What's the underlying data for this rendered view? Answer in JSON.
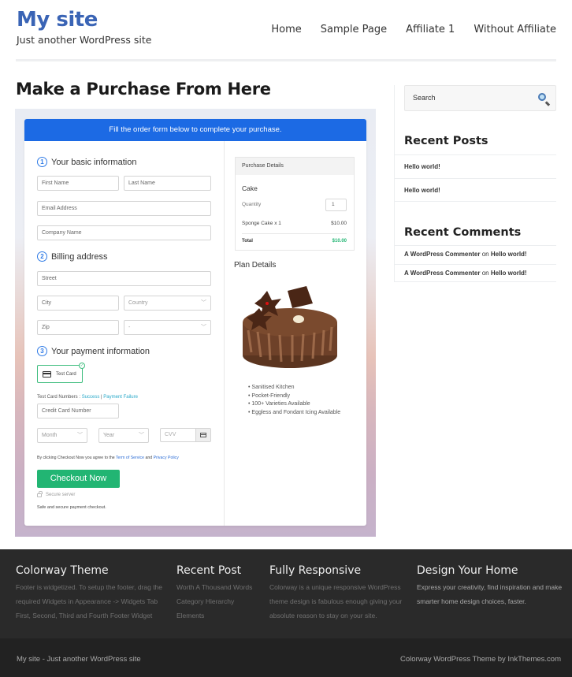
{
  "header": {
    "site_title": "My site",
    "tagline": "Just another WordPress site",
    "nav": [
      "Home",
      "Sample Page",
      "Affiliate 1",
      "Without Affiliate"
    ]
  },
  "main": {
    "page_title": "Make a Purchase From Here",
    "banner": "Fill the order form below to complete your purchase.",
    "steps": [
      {
        "num": "1",
        "label": "Your basic information"
      },
      {
        "num": "2",
        "label": "Billing address"
      },
      {
        "num": "3",
        "label": "Your payment information"
      }
    ],
    "fields": {
      "first_name": "First Name",
      "last_name": "Last Name",
      "email": "Email Address",
      "company": "Company Name",
      "street": "Street",
      "city": "City",
      "country": "Country",
      "zip": "Zip",
      "state": "-",
      "card_number": "Credit Card Number",
      "month": "Month",
      "year": "Year",
      "cvv": "CVV"
    },
    "payment_method": "Test Card",
    "test_numbers_label": "Test Card Numbers : ",
    "test_success": "Success",
    "test_sep": " | ",
    "test_failure": "Payment Failure",
    "agree_prefix": "By clicking Checkout Now you agree to the ",
    "terms_link": "Term of Service",
    "agree_and": " and ",
    "privacy_link": "Privacy Policy",
    "checkout_button": "Checkout Now",
    "secure_server": "Secure server",
    "safe_text": "Safe and secure payment checkout.",
    "purchase": {
      "header": "Purchase Details",
      "item": "Cake",
      "quantity_label": "Quantity",
      "quantity": "1",
      "line_label": "Sponge Cake x 1",
      "line_amount": "$10.00",
      "total_label": "Total",
      "total_amount": "$10.00"
    },
    "plan_title": "Plan Details",
    "features": [
      "Sanitised Kitchen",
      "Pocket-Friendly",
      "100+ Varieties Available",
      "Eggless and Fondant Icing Available"
    ]
  },
  "sidebar": {
    "search_placeholder": "Search",
    "recent_posts_title": "Recent Posts",
    "recent_posts": [
      "Hello world!",
      "Hello world!"
    ],
    "recent_comments_title": "Recent Comments",
    "recent_comments": [
      {
        "author": "A WordPress Commenter",
        "on": " on ",
        "post": "Hello world!"
      },
      {
        "author": "A WordPress Commenter",
        "on": " on ",
        "post": "Hello world!"
      }
    ]
  },
  "footer": {
    "cols": [
      {
        "title": "Colorway Theme",
        "lines": [
          "Footer is widgetized. To setup the footer, drag the",
          "required Widgets in Appearance -> Widgets Tab",
          "First, Second, Third and Fourth Footer Widget"
        ]
      },
      {
        "title": "Recent Post",
        "lines": [
          "Worth A Thousand Words",
          "Category Hierarchy",
          "Elements"
        ]
      },
      {
        "title": "Fully Responsive",
        "lines": [
          "Colorway is a unique responsive WordPress",
          "theme design is fabulous enough giving your",
          "absolute reason to stay on your site."
        ]
      },
      {
        "title": "Design Your Home",
        "lines": [
          "Express your creativity, find inspiration and make",
          "smarter home design choices, faster."
        ]
      }
    ],
    "bottom_left": "My site - Just another WordPress site",
    "bottom_right": "Colorway WordPress Theme by InkThemes.com"
  }
}
